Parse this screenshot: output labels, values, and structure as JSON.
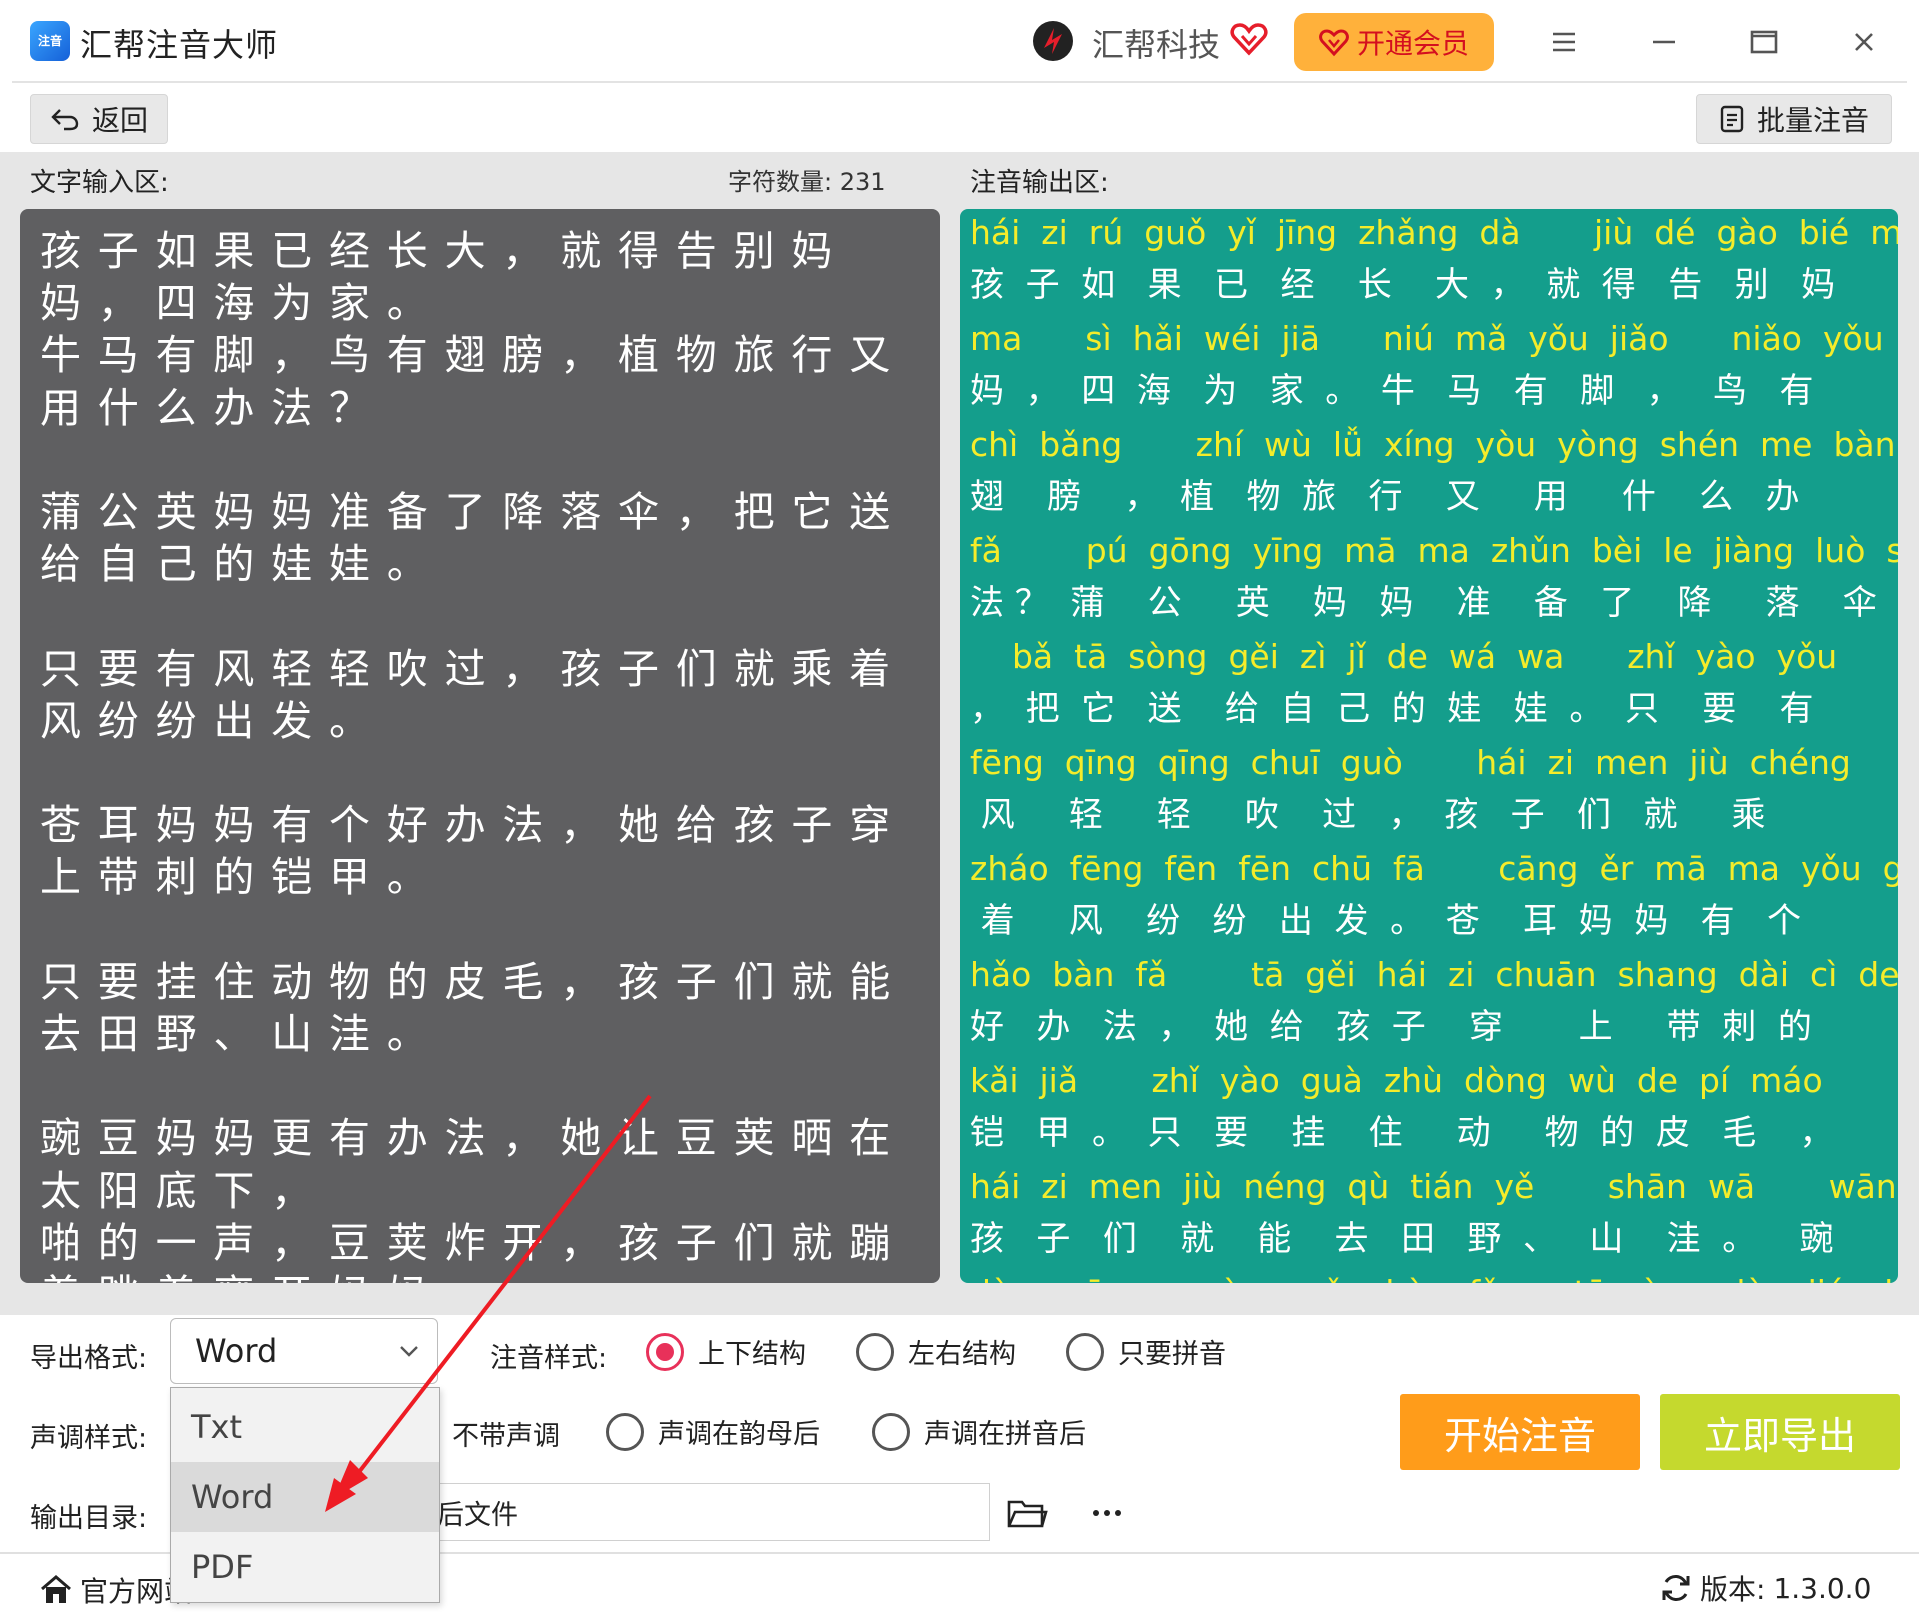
{
  "titlebar": {
    "app_title": "汇帮注音大师",
    "app_logo_text": "注音",
    "brand_name": "汇帮科技",
    "vip_label": "开通会员"
  },
  "toolbar": {
    "back_label": "返回",
    "batch_label": "批量注音"
  },
  "input_area": {
    "label": "文字输入区:",
    "char_count": "字符数量: 231",
    "text": "孩子如果已经长大，就得告别妈妈，四海为家。\n牛马有脚，鸟有翅膀，植物旅行又用什么办法？\n\n蒲公英妈妈准备了降落伞，把它送给自己的娃娃。\n\n只要有风轻轻吹过，孩子们就乘着风纷纷出发。\n\n苍耳妈妈有个好办法，她给孩子穿上带刺的铠甲。\n\n只要挂住动物的皮毛，孩子们就能去田野、山洼。\n\n豌豆妈妈更有办法，她让豆荚晒在太阳底下，\n啪的一声，豆荚炸开，孩子们就蹦着跳着离开妈妈。"
  },
  "output_area": {
    "label": "注音输出区:",
    "lines": [
      {
        "pinyin": "hái  zi  rú  guǒ  yǐ  jīng  zhǎng  dà       jiù  dé  gào  bié  mā",
        "hanzi": "孩  子  如   果   已   经    长    大  ，  就  得   告   别   妈"
      },
      {
        "pinyin": "ma      sì  hǎi  wéi  jiā      niú  mǎ  yǒu  jiǎo      niǎo  yǒu",
        "hanzi": "妈  ，  四  海   为   家  。  牛   马   有   脚   ，   鸟   有"
      },
      {
        "pinyin": "chì  bǎng       zhí  wù  lǚ  xíng  yòu  yòng  shén  me  bàn",
        "hanzi": "翅    膀    ，  植   物  旅   行    又     用     什    么   办"
      },
      {
        "pinyin": "fǎ        pú  gōng  yīng  mā  ma  zhǔn  bèi  le  jiàng  luò  sǎn",
        "hanzi": "法 ？  蒲    公     英    妈   妈    准    备   了    降     落    伞"
      },
      {
        "pinyin": "    bǎ  tā  sòng  gěi  zì  jǐ  de  wá  wa      zhǐ  yào  yǒu",
        "hanzi": "，  把  它   送    给  自  己  的  娃   娃  。  只    要    有"
      },
      {
        "pinyin": "fēng  qīng  qīng  chuī  guò       hái  zi  men  jiù  chéng",
        "hanzi": " 风     轻     轻     吹    过   ，  孩   子   们   就     乘"
      },
      {
        "pinyin": "zháo  fēng  fēn  fēn  chū  fā       cāng  ěr  mā  ma  yǒu  gè",
        "hanzi": " 着     风    纷   纷   出  发  。  苍    耳  妈  妈   有   个"
      },
      {
        "pinyin": "hǎo  bàn  fǎ        tā  gěi  hái  zi  chuān  shang  dài  cì  de",
        "hanzi": "好   办   法  ，  她  给   孩  子    穿       上     带  刺  的"
      },
      {
        "pinyin": "kǎi  jiǎ       zhǐ  yào  guà  zhù  dòng  wù  de  pí  máo",
        "hanzi": "铠   甲  。  只   要    挂    住     动     物  的  皮   毛    ，"
      },
      {
        "pinyin": "hái  zi  men  jiù  néng  qù  tián  yě       shān  wā       wān",
        "hanzi": "孩   子   们    就    能    去   田   野  、   山    洼  。    豌"
      },
      {
        "pinyin": "dòu  mā  ma  gèng  yǒu  bàn  fǎ       tā  ràng  dòu  jiá  shài",
        "hanzi": ""
      }
    ]
  },
  "controls": {
    "export_format_label": "导出格式:",
    "export_format_value": "Word",
    "style_label": "注音样式:",
    "style_options": [
      "上下结构",
      "左右结构",
      "只要拼音"
    ],
    "tone_label": "声调样式:",
    "tone_options": [
      "不带声调",
      "声调在韵母后",
      "声调在拼音后"
    ],
    "output_dir_label": "输出目录:",
    "output_dir_value": "后文件",
    "start_label": "开始注音",
    "export_label": "立即导出"
  },
  "dropdown": {
    "options": [
      "Txt",
      "Word",
      "PDF"
    ],
    "selected": "Word"
  },
  "footer": {
    "home_label": "官方网站",
    "version_label": "版本:",
    "version_value": "1.3.0.0"
  },
  "colors": {
    "output_bg": "#149e8c",
    "pinyin": "#f5ec2a",
    "input_bg": "#5f5f61",
    "start_btn": "#ff9c1a",
    "export_btn": "#c5d92e",
    "vip_btn": "#ffb13b",
    "radio_on": "#e8315a",
    "arrow": "#ee1c24"
  }
}
